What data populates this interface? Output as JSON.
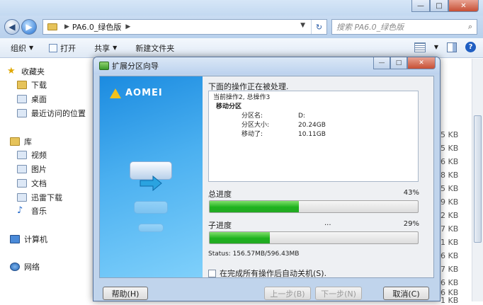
{
  "explorer": {
    "address": {
      "path": "PA6.0_绿色版"
    },
    "search": {
      "placeholder": "搜索 PA6.0_绿色版"
    },
    "toolbar": {
      "organize": "组织",
      "open": "打开",
      "share": "共享",
      "new_folder": "新建文件夹"
    },
    "sidebar": {
      "favorites": "收藏夹",
      "downloads": "下载",
      "desktop": "桌面",
      "recent": "最近访问的位置",
      "library": "库",
      "videos": "视频",
      "pictures": "图片",
      "documents": "文档",
      "thunder": "迅雷下载",
      "music": "音乐",
      "computer": "计算机",
      "network": "网络"
    },
    "size_fragments": [
      "5 KB",
      "5 KB",
      "6 KB",
      "8 KB",
      "5 KB",
      "9 KB",
      "2 KB",
      "7 KB",
      "1 KB",
      "6 KB",
      "7 KB",
      "6 KB",
      "6 KB",
      "1 KB"
    ]
  },
  "dialog": {
    "title": "扩展分区向导",
    "brand": "AOMEI",
    "header": "下面的操作正在被处理.",
    "log": {
      "line1": "当前操作2, 总操作3",
      "op": "移动分区",
      "rows": [
        {
          "k": "分区名:",
          "v": "D:"
        },
        {
          "k": "分区大小:",
          "v": "20.24GB"
        },
        {
          "k": "移动了:",
          "v": "10.11GB"
        }
      ]
    },
    "total_label": "总进度",
    "total_pct": "43%",
    "total_value": 43,
    "sub_label": "子进度",
    "sub_dots": "...",
    "sub_pct": "29%",
    "sub_value": 29,
    "status": "Status: 156.57MB/596.43MB",
    "shutdown_label": "在完成所有操作后自动关机(S).",
    "buttons": {
      "help": "帮助(H)",
      "back": "上一步(B)",
      "next": "下一步(N)",
      "cancel": "取消(C)"
    }
  }
}
